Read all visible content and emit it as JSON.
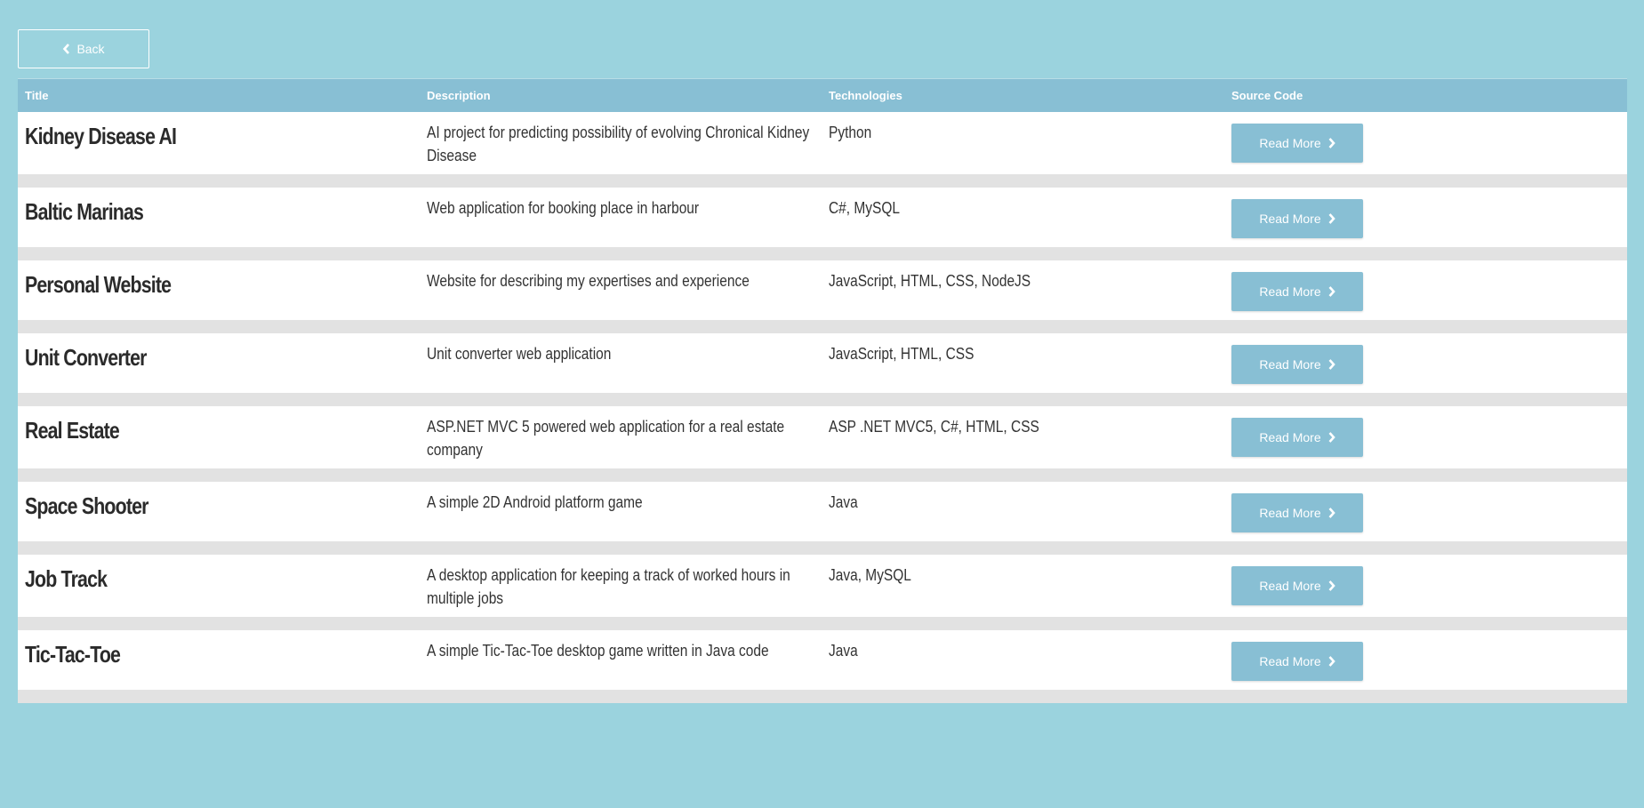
{
  "back_button": {
    "label": "Back"
  },
  "table": {
    "headers": [
      "Title",
      "Description",
      "Technologies",
      "Source Code"
    ],
    "rows": [
      {
        "title": "Kidney Disease AI",
        "description": "AI project for predicting possibility of evolving Chronical Kidney Disease",
        "technologies": "Python",
        "button": "Read More"
      },
      {
        "title": "Baltic Marinas",
        "description": "Web application for booking place in harbour",
        "technologies": "C#, MySQL",
        "button": "Read More"
      },
      {
        "title": "Personal Website",
        "description": "Website for describing my expertises and experience",
        "technologies": "JavaScript, HTML, CSS, NodeJS",
        "button": "Read More"
      },
      {
        "title": "Unit Converter",
        "description": "Unit converter web application",
        "technologies": "JavaScript, HTML, CSS",
        "button": "Read More"
      },
      {
        "title": "Real Estate",
        "description": "ASP.NET MVC 5 powered web application for a real estate company",
        "technologies": "ASP .NET MVC5, C#, HTML, CSS",
        "button": "Read More"
      },
      {
        "title": "Space Shooter",
        "description": "A simple 2D Android platform game",
        "technologies": "Java",
        "button": "Read More"
      },
      {
        "title": "Job Track",
        "description": "A desktop application for keeping a track of worked hours in multiple jobs",
        "technologies": "Java, MySQL",
        "button": "Read More"
      },
      {
        "title": "Tic-Tac-Toe",
        "description": "A simple Tic-Tac-Toe desktop game written in Java code",
        "technologies": "Java",
        "button": "Read More"
      }
    ]
  },
  "colors": {
    "background": "#9bd3de",
    "header": "#88bfd4",
    "button": "#88bfd4",
    "row_gap": "#e2e2e2"
  },
  "icons": {
    "back": "chevron-left-icon",
    "read_more": "chevron-right-icon"
  }
}
